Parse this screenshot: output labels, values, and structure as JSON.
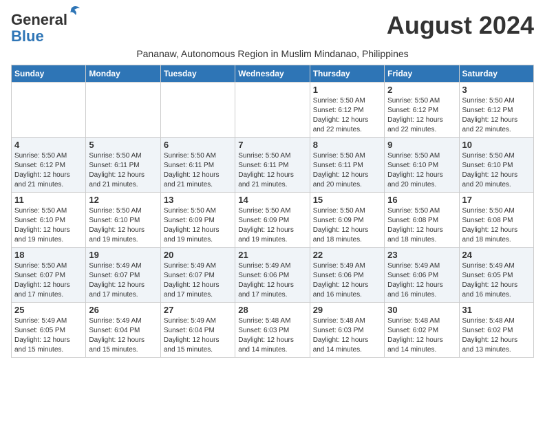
{
  "header": {
    "logo_line1": "General",
    "logo_line2": "Blue",
    "month_title": "August 2024",
    "subtitle": "Pananaw, Autonomous Region in Muslim Mindanao, Philippines"
  },
  "weekdays": [
    "Sunday",
    "Monday",
    "Tuesday",
    "Wednesday",
    "Thursday",
    "Friday",
    "Saturday"
  ],
  "weeks": [
    [
      {
        "day": "",
        "info": ""
      },
      {
        "day": "",
        "info": ""
      },
      {
        "day": "",
        "info": ""
      },
      {
        "day": "",
        "info": ""
      },
      {
        "day": "1",
        "info": "Sunrise: 5:50 AM\nSunset: 6:12 PM\nDaylight: 12 hours\nand 22 minutes."
      },
      {
        "day": "2",
        "info": "Sunrise: 5:50 AM\nSunset: 6:12 PM\nDaylight: 12 hours\nand 22 minutes."
      },
      {
        "day": "3",
        "info": "Sunrise: 5:50 AM\nSunset: 6:12 PM\nDaylight: 12 hours\nand 22 minutes."
      }
    ],
    [
      {
        "day": "4",
        "info": "Sunrise: 5:50 AM\nSunset: 6:12 PM\nDaylight: 12 hours\nand 21 minutes."
      },
      {
        "day": "5",
        "info": "Sunrise: 5:50 AM\nSunset: 6:11 PM\nDaylight: 12 hours\nand 21 minutes."
      },
      {
        "day": "6",
        "info": "Sunrise: 5:50 AM\nSunset: 6:11 PM\nDaylight: 12 hours\nand 21 minutes."
      },
      {
        "day": "7",
        "info": "Sunrise: 5:50 AM\nSunset: 6:11 PM\nDaylight: 12 hours\nand 21 minutes."
      },
      {
        "day": "8",
        "info": "Sunrise: 5:50 AM\nSunset: 6:11 PM\nDaylight: 12 hours\nand 20 minutes."
      },
      {
        "day": "9",
        "info": "Sunrise: 5:50 AM\nSunset: 6:10 PM\nDaylight: 12 hours\nand 20 minutes."
      },
      {
        "day": "10",
        "info": "Sunrise: 5:50 AM\nSunset: 6:10 PM\nDaylight: 12 hours\nand 20 minutes."
      }
    ],
    [
      {
        "day": "11",
        "info": "Sunrise: 5:50 AM\nSunset: 6:10 PM\nDaylight: 12 hours\nand 19 minutes."
      },
      {
        "day": "12",
        "info": "Sunrise: 5:50 AM\nSunset: 6:10 PM\nDaylight: 12 hours\nand 19 minutes."
      },
      {
        "day": "13",
        "info": "Sunrise: 5:50 AM\nSunset: 6:09 PM\nDaylight: 12 hours\nand 19 minutes."
      },
      {
        "day": "14",
        "info": "Sunrise: 5:50 AM\nSunset: 6:09 PM\nDaylight: 12 hours\nand 19 minutes."
      },
      {
        "day": "15",
        "info": "Sunrise: 5:50 AM\nSunset: 6:09 PM\nDaylight: 12 hours\nand 18 minutes."
      },
      {
        "day": "16",
        "info": "Sunrise: 5:50 AM\nSunset: 6:08 PM\nDaylight: 12 hours\nand 18 minutes."
      },
      {
        "day": "17",
        "info": "Sunrise: 5:50 AM\nSunset: 6:08 PM\nDaylight: 12 hours\nand 18 minutes."
      }
    ],
    [
      {
        "day": "18",
        "info": "Sunrise: 5:50 AM\nSunset: 6:07 PM\nDaylight: 12 hours\nand 17 minutes."
      },
      {
        "day": "19",
        "info": "Sunrise: 5:49 AM\nSunset: 6:07 PM\nDaylight: 12 hours\nand 17 minutes."
      },
      {
        "day": "20",
        "info": "Sunrise: 5:49 AM\nSunset: 6:07 PM\nDaylight: 12 hours\nand 17 minutes."
      },
      {
        "day": "21",
        "info": "Sunrise: 5:49 AM\nSunset: 6:06 PM\nDaylight: 12 hours\nand 17 minutes."
      },
      {
        "day": "22",
        "info": "Sunrise: 5:49 AM\nSunset: 6:06 PM\nDaylight: 12 hours\nand 16 minutes."
      },
      {
        "day": "23",
        "info": "Sunrise: 5:49 AM\nSunset: 6:06 PM\nDaylight: 12 hours\nand 16 minutes."
      },
      {
        "day": "24",
        "info": "Sunrise: 5:49 AM\nSunset: 6:05 PM\nDaylight: 12 hours\nand 16 minutes."
      }
    ],
    [
      {
        "day": "25",
        "info": "Sunrise: 5:49 AM\nSunset: 6:05 PM\nDaylight: 12 hours\nand 15 minutes."
      },
      {
        "day": "26",
        "info": "Sunrise: 5:49 AM\nSunset: 6:04 PM\nDaylight: 12 hours\nand 15 minutes."
      },
      {
        "day": "27",
        "info": "Sunrise: 5:49 AM\nSunset: 6:04 PM\nDaylight: 12 hours\nand 15 minutes."
      },
      {
        "day": "28",
        "info": "Sunrise: 5:48 AM\nSunset: 6:03 PM\nDaylight: 12 hours\nand 14 minutes."
      },
      {
        "day": "29",
        "info": "Sunrise: 5:48 AM\nSunset: 6:03 PM\nDaylight: 12 hours\nand 14 minutes."
      },
      {
        "day": "30",
        "info": "Sunrise: 5:48 AM\nSunset: 6:02 PM\nDaylight: 12 hours\nand 14 minutes."
      },
      {
        "day": "31",
        "info": "Sunrise: 5:48 AM\nSunset: 6:02 PM\nDaylight: 12 hours\nand 13 minutes."
      }
    ]
  ]
}
